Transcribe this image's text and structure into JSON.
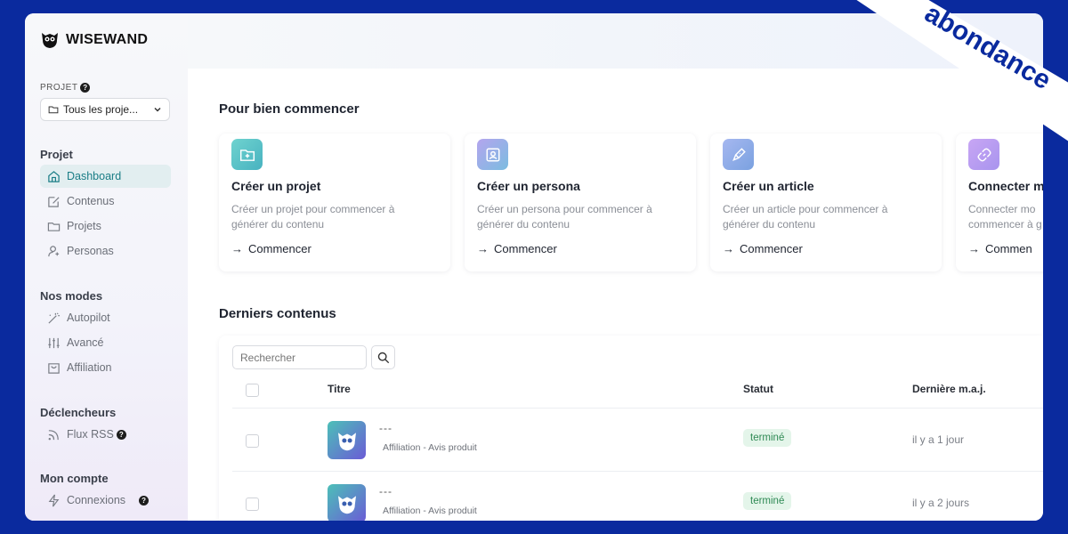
{
  "brand": {
    "logo_text": "WISEWAND",
    "badge_text": "abondance"
  },
  "sidebar": {
    "project_label": "PROJET",
    "project_select": "Tous les proje...",
    "sections": [
      {
        "title": "Projet",
        "items": [
          {
            "label": "Dashboard",
            "icon": "home-icon",
            "active": true
          },
          {
            "label": "Contenus",
            "icon": "edit-icon"
          },
          {
            "label": "Projets",
            "icon": "folder-icon"
          },
          {
            "label": "Personas",
            "icon": "user-icon"
          }
        ]
      },
      {
        "title": "Nos modes",
        "items": [
          {
            "label": "Autopilot",
            "icon": "wand-icon"
          },
          {
            "label": "Avancé",
            "icon": "sliders-icon"
          },
          {
            "label": "Affiliation",
            "icon": "bag-icon"
          }
        ]
      },
      {
        "title": "Déclencheurs",
        "items": [
          {
            "label": "Flux RSS",
            "icon": "rss-icon"
          }
        ]
      },
      {
        "title": "Mon compte",
        "items": [
          {
            "label": "Connexions",
            "icon": "bolt-icon"
          }
        ]
      }
    ]
  },
  "main": {
    "getting_started_title": "Pour bien commencer",
    "cards": [
      {
        "title": "Créer un projet",
        "desc_line1": "Créer un projet pour commencer à",
        "desc_line2": "générer du contenu",
        "link": "Commencer",
        "icon": "folder-plus-icon",
        "color": "#5bc4c4"
      },
      {
        "title": "Créer un persona",
        "desc_line1": "Créer un persona pour commencer à",
        "desc_line2": "générer du contenu",
        "link": "Commencer",
        "icon": "portrait-icon",
        "color": "#9a8fe0"
      },
      {
        "title": "Créer un article",
        "desc_line1": "Créer un article pour commencer à",
        "desc_line2": "générer du contenu",
        "link": "Commencer",
        "icon": "pen-icon",
        "color": "#8aa6e6"
      },
      {
        "title": "Connecter m",
        "desc_line1": "Connecter mo",
        "desc_line2": "commencer à g",
        "link": "Commen",
        "icon": "link-icon",
        "color": "#b79cf0"
      }
    ],
    "latest_title": "Derniers contenus",
    "search_placeholder": "Rechercher",
    "table": {
      "headers": {
        "title": "Titre",
        "status": "Statut",
        "updated": "Dernière m.a.j."
      },
      "rows": [
        {
          "title": "---",
          "subtitle": "Affiliation - Avis produit",
          "status": "terminé",
          "updated": "il y a 1 jour"
        },
        {
          "title": "---",
          "subtitle": "Affiliation - Avis produit",
          "status": "terminé",
          "updated": "il y a 2 jours"
        }
      ]
    }
  }
}
